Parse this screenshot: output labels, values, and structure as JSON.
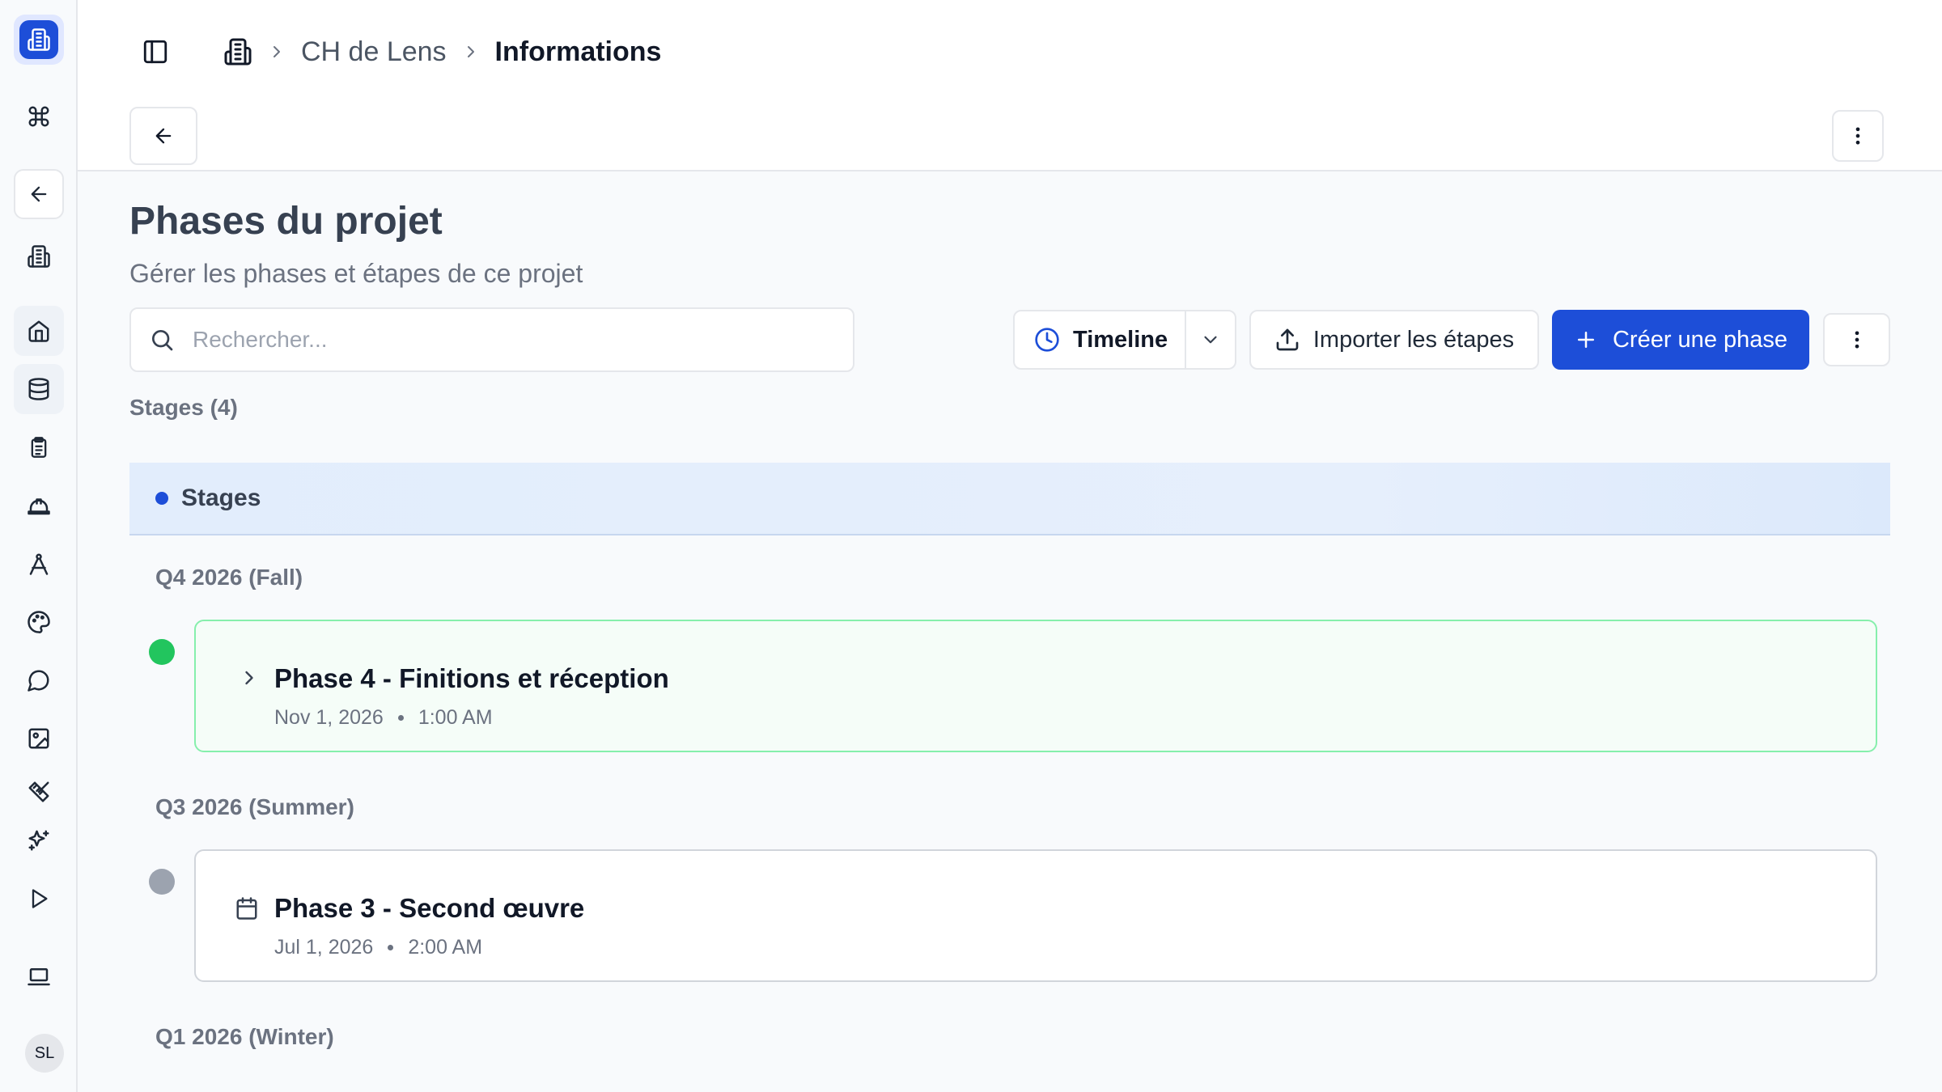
{
  "sidebar": {
    "avatar_initials": "SL",
    "items": [
      {
        "icon": "command-icon"
      },
      {
        "icon": "arrow-left-icon"
      },
      {
        "icon": "building-icon"
      },
      {
        "icon": "home-icon"
      },
      {
        "icon": "database-icon"
      },
      {
        "icon": "clipboard-icon"
      },
      {
        "icon": "hard-hat-icon"
      },
      {
        "icon": "compass-icon"
      },
      {
        "icon": "palette-icon"
      },
      {
        "icon": "message-circle-icon"
      },
      {
        "icon": "image-icon"
      },
      {
        "icon": "ruler-pencil-icon"
      },
      {
        "icon": "sparkles-icon"
      },
      {
        "icon": "play-icon"
      },
      {
        "icon": "laptop-icon"
      }
    ]
  },
  "breadcrumb": {
    "project": "CH de Lens",
    "current": "Informations"
  },
  "page": {
    "title": "Phases du projet",
    "subtitle": "Gérer les phases et étapes de ce projet"
  },
  "search": {
    "placeholder": "Rechercher...",
    "value": ""
  },
  "toolbar": {
    "view_label": "Timeline",
    "import_label": "Importer les étapes",
    "create_label": "Créer une phase"
  },
  "stages_count_label": "Stages (4)",
  "group": {
    "label": "Stages",
    "accent_color": "#1d4ed8"
  },
  "quarters": [
    {
      "label": "Q4 2026 (Fall)",
      "phase": {
        "title": "Phase 4 - Finitions et réception",
        "date": "Nov 1, 2026",
        "time": "1:00 AM",
        "status_color": "#22c55e",
        "icon": "chevron-right-icon"
      }
    },
    {
      "label": "Q3 2026 (Summer)",
      "phase": {
        "title": "Phase 3 - Second œuvre",
        "date": "Jul 1, 2026",
        "time": "2:00 AM",
        "status_color": "#9ca3af",
        "icon": "calendar-icon"
      }
    },
    {
      "label": "Q1 2026 (Winter)"
    }
  ],
  "colors": {
    "primary": "#1d4ed8",
    "active_border": "#86efac",
    "background": "#f8fafc"
  }
}
